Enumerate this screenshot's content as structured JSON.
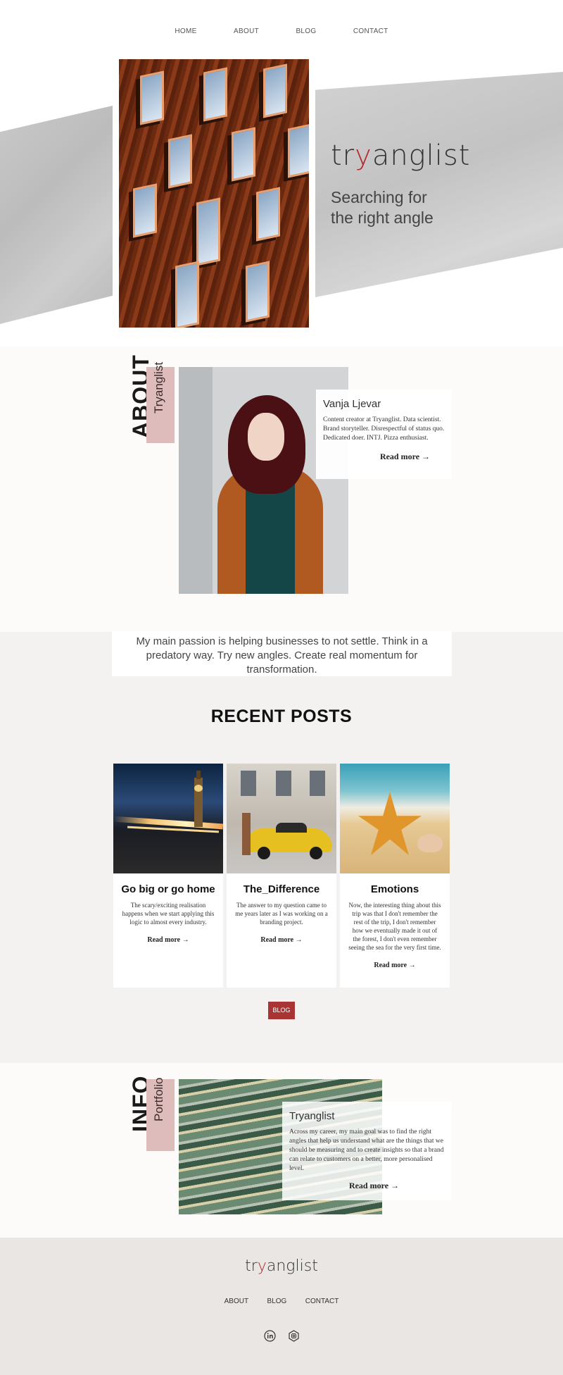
{
  "nav": {
    "home": "HOME",
    "about": "ABOUT",
    "blog": "BLOG",
    "contact": "CONTACT"
  },
  "hero": {
    "brand_pre": "tr",
    "brand_v": "y",
    "brand_post": "anglist",
    "tagline": "Searching for the right angle"
  },
  "about": {
    "heading": "ABOUT",
    "tab": "Tryanglist",
    "name": "Vanja Ljevar",
    "desc": "Content creator at Tryanglist. Data scientist. Brand storyteller. Disrespectful of status quo. Dedicated doer. INTJ. Pizza enthusiast.",
    "more": "Read more →"
  },
  "passion": "My main passion is helping businesses to not settle. Think in a predatory way. Try new angles. Create real momentum for transformation.",
  "recent": {
    "title": "RECENT POSTS",
    "posts": [
      {
        "title": "Go big or go home",
        "excerpt": "The scary/exciting realisation happens when we start applying this logic to almost every industry.",
        "more": "Read more →"
      },
      {
        "title": "The_Difference",
        "excerpt": "The answer to my question came to me years later as I was working on a branding project.",
        "more": "Read more →"
      },
      {
        "title": "Emotions",
        "excerpt": "Now, the interesting thing about this trip was that I don't remember the rest of the trip, I don't remember how we eventually made it out of the forest, I don't even remember seeing the sea for the very first time.",
        "more": "Read more →"
      }
    ],
    "blog_button": "BLOG"
  },
  "info": {
    "heading": "INFO",
    "tab": "Portfolio",
    "name": "Tryanglist",
    "desc": "Across my career, my main goal was to find the right angles that help us understand what are the things that we should be measuring and to create insights so that a brand can relate to customers on a better, more personalised level.",
    "more": "Read more →"
  },
  "footer": {
    "brand_pre": "tr",
    "brand_v": "y",
    "brand_post": "anglist",
    "nav": {
      "about": "ABOUT",
      "blog": "BLOG",
      "contact": "CONTACT"
    },
    "icons": [
      "linkedin-icon",
      "instagram-icon"
    ]
  },
  "colors": {
    "accent": "#b32a2a",
    "pink_tab": "#dfbcbc",
    "button": "#a83434"
  }
}
